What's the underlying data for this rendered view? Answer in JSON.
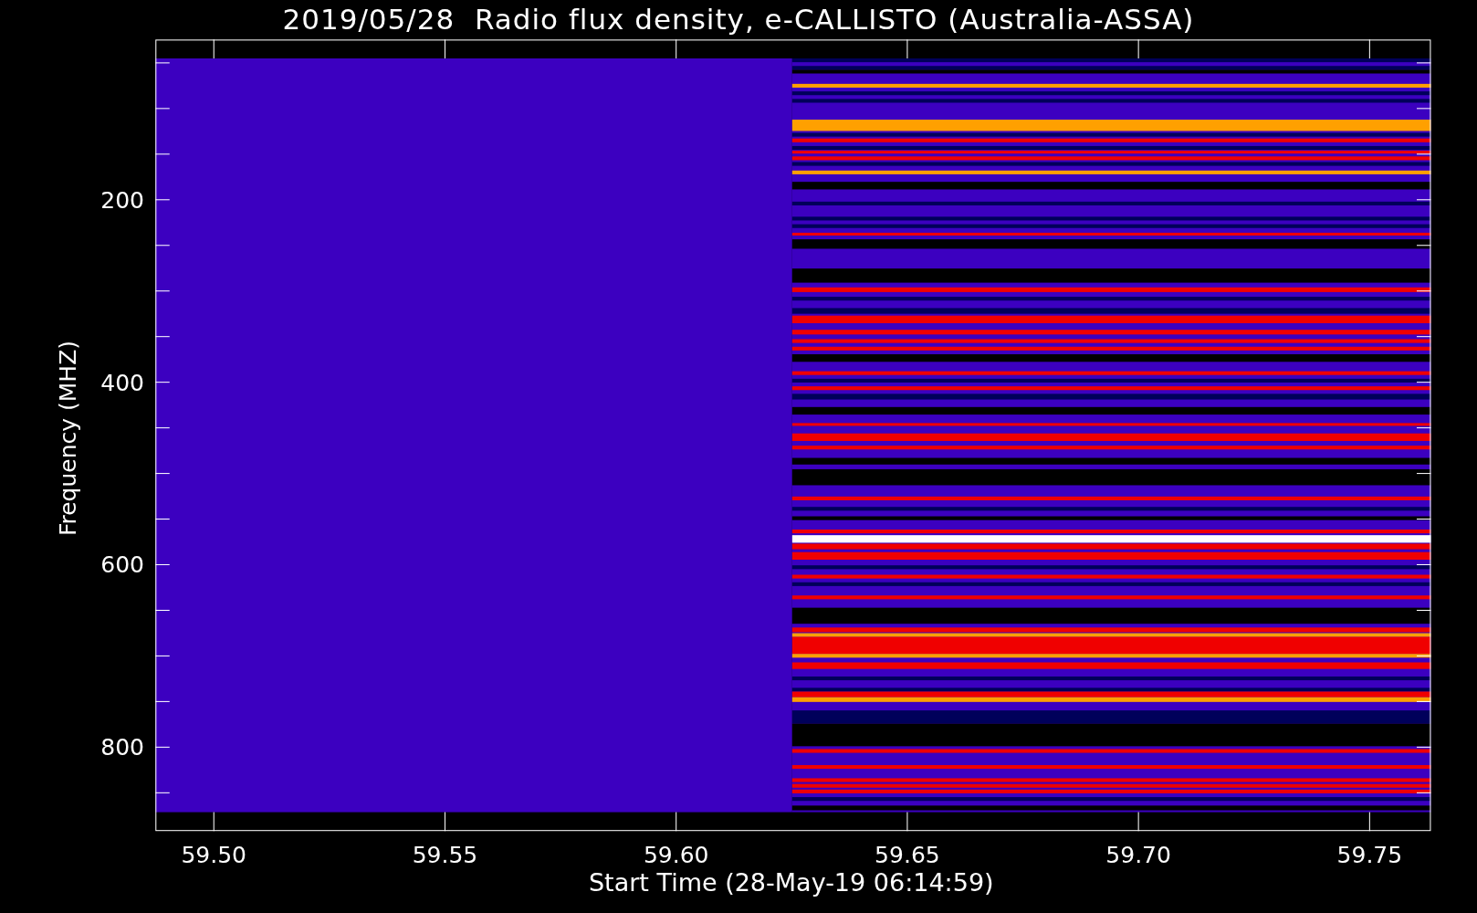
{
  "title": "2019/05/28  Radio flux density, e-CALLISTO (Australia-ASSA)",
  "y_axis": {
    "label": "Frequency (MHZ)",
    "ticks": [
      "200",
      "400",
      "600",
      "800"
    ]
  },
  "x_axis": {
    "label": "Start Time (28-May-19 06:14:59)",
    "ticks": [
      "59.50",
      "59.55",
      "59.60",
      "59.65",
      "59.70",
      "59.75"
    ]
  }
}
